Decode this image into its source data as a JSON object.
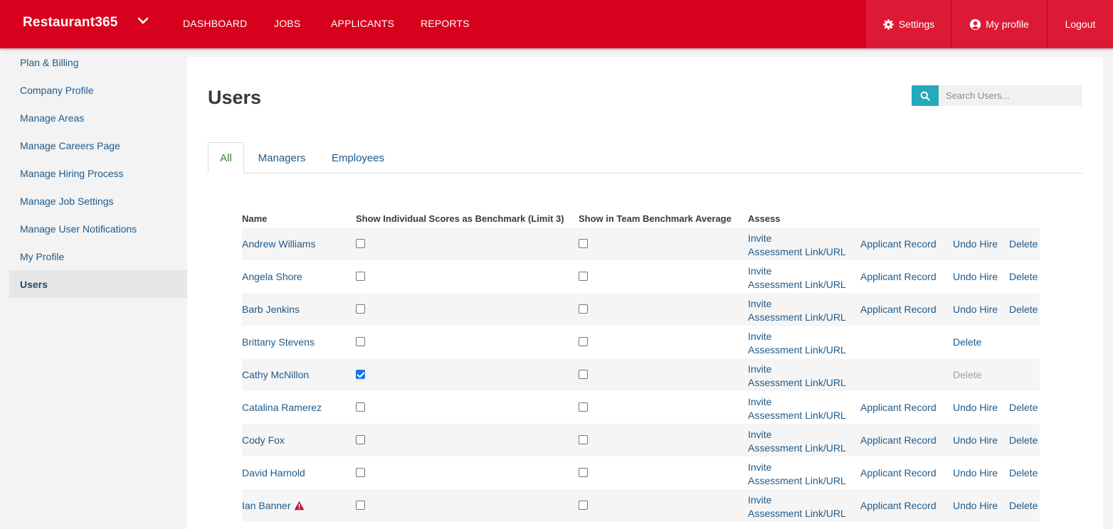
{
  "header": {
    "brand": "Restaurant365",
    "nav": [
      "DASHBOARD",
      "JOBS",
      "APPLICANTS",
      "REPORTS"
    ],
    "settings_label": "Settings",
    "profile_label": "My profile",
    "logout_label": "Logout"
  },
  "sidebar": {
    "items": [
      {
        "label": "Plan & Billing"
      },
      {
        "label": "Company Profile"
      },
      {
        "label": "Manage Areas"
      },
      {
        "label": "Manage Careers Page"
      },
      {
        "label": "Manage Hiring Process"
      },
      {
        "label": "Manage Job Settings"
      },
      {
        "label": "Manage User Notifications"
      },
      {
        "label": "My Profile"
      },
      {
        "label": "Users",
        "active": true
      }
    ]
  },
  "main": {
    "title": "Users",
    "search_placeholder": "Search Users...",
    "tabs": [
      "All",
      "Managers",
      "Employees"
    ],
    "active_tab": "All",
    "columns": [
      "Name",
      "Show Individual Scores as Benchmark (Limit 3)",
      "Show in Team Benchmark Average",
      "Assess"
    ],
    "invite_label": "Invite",
    "assessment_label": "Assessment Link/URL",
    "applicant_label": "Applicant Record",
    "undo_label": "Undo Hire",
    "delete_label": "Delete",
    "rows": [
      {
        "name": "Andrew Williams",
        "benchmark": false,
        "team": false,
        "applicant": true,
        "undo": true,
        "delete_enabled": true,
        "warning": false
      },
      {
        "name": "Angela Shore",
        "benchmark": false,
        "team": false,
        "applicant": true,
        "undo": true,
        "delete_enabled": true,
        "warning": false
      },
      {
        "name": "Barb Jenkins",
        "benchmark": false,
        "team": false,
        "applicant": true,
        "undo": true,
        "delete_enabled": true,
        "warning": false
      },
      {
        "name": "Brittany Stevens",
        "benchmark": false,
        "team": false,
        "applicant": false,
        "undo": false,
        "delete_enabled": true,
        "warning": false
      },
      {
        "name": "Cathy McNillon",
        "benchmark": true,
        "team": false,
        "applicant": false,
        "undo": false,
        "delete_enabled": false,
        "warning": false
      },
      {
        "name": "Catalina Ramerez",
        "benchmark": false,
        "team": false,
        "applicant": true,
        "undo": true,
        "delete_enabled": true,
        "warning": false
      },
      {
        "name": "Cody Fox",
        "benchmark": false,
        "team": false,
        "applicant": true,
        "undo": true,
        "delete_enabled": true,
        "warning": false
      },
      {
        "name": "David Harnold",
        "benchmark": false,
        "team": false,
        "applicant": true,
        "undo": true,
        "delete_enabled": true,
        "warning": false
      },
      {
        "name": "Ian Banner",
        "benchmark": false,
        "team": false,
        "applicant": true,
        "undo": true,
        "delete_enabled": true,
        "warning": true
      }
    ]
  },
  "colors": {
    "brand_red": "#d7001d",
    "link_blue": "#1f5a8a",
    "search_teal": "#26a9bd",
    "active_tab_green": "#2f8a2f"
  }
}
